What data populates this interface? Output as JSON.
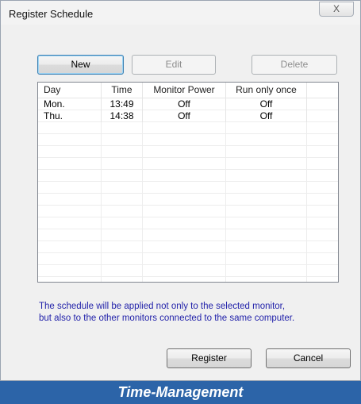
{
  "window": {
    "title": "Register Schedule",
    "close_label": "X"
  },
  "toolbar": {
    "new_label": "New",
    "edit_label": "Edit",
    "delete_label": "Delete"
  },
  "table": {
    "headers": [
      "Day",
      "Time",
      "Monitor Power",
      "Run only once"
    ],
    "rows": [
      {
        "day": "Mon.",
        "time": "13:49",
        "power": "Off",
        "once": "Off"
      },
      {
        "day": "Thu.",
        "time": "14:38",
        "power": "Off",
        "once": "Off"
      }
    ]
  },
  "note": {
    "line1": "The schedule will be applied not only to the selected monitor,",
    "line2": "but also to the other monitors connected to the same computer."
  },
  "footer": {
    "register_label": "Register",
    "cancel_label": "Cancel"
  },
  "banner": {
    "text": "Time-Management"
  },
  "colors": {
    "note_text": "#2222aa",
    "banner_bg": "#2c64a8"
  }
}
